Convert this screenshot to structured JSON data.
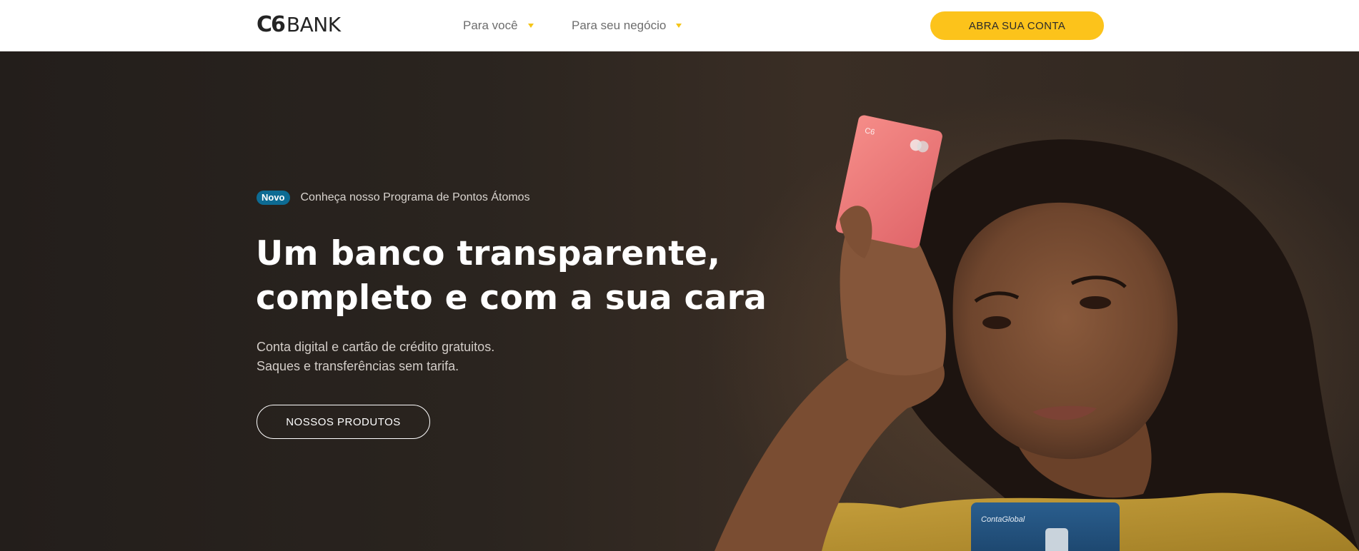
{
  "header": {
    "logo_mark": "C6",
    "logo_word": "BANK",
    "nav": [
      {
        "label": "Para você"
      },
      {
        "label": "Para seu negócio"
      }
    ],
    "cta_label": "ABRA SUA CONTA"
  },
  "hero": {
    "badge": "Novo",
    "promo_link": "Conheça nosso Programa de Pontos Átomos",
    "headline_line1": "Um banco transparente,",
    "headline_line2": "completo e com a sua cara",
    "sub_line1": "Conta digital e cartão de crédito gratuitos.",
    "sub_line2": "Saques e transferências sem tarifa.",
    "button_label": "NOSSOS PRODUTOS",
    "card_label": "ContaGlobal"
  },
  "colors": {
    "accent_yellow": "#fcc31b",
    "badge_blue": "#0d6b93",
    "hero_bg": "#231e1b",
    "card_pink": "#f07a7a",
    "card_blue": "#1f4d7a"
  }
}
